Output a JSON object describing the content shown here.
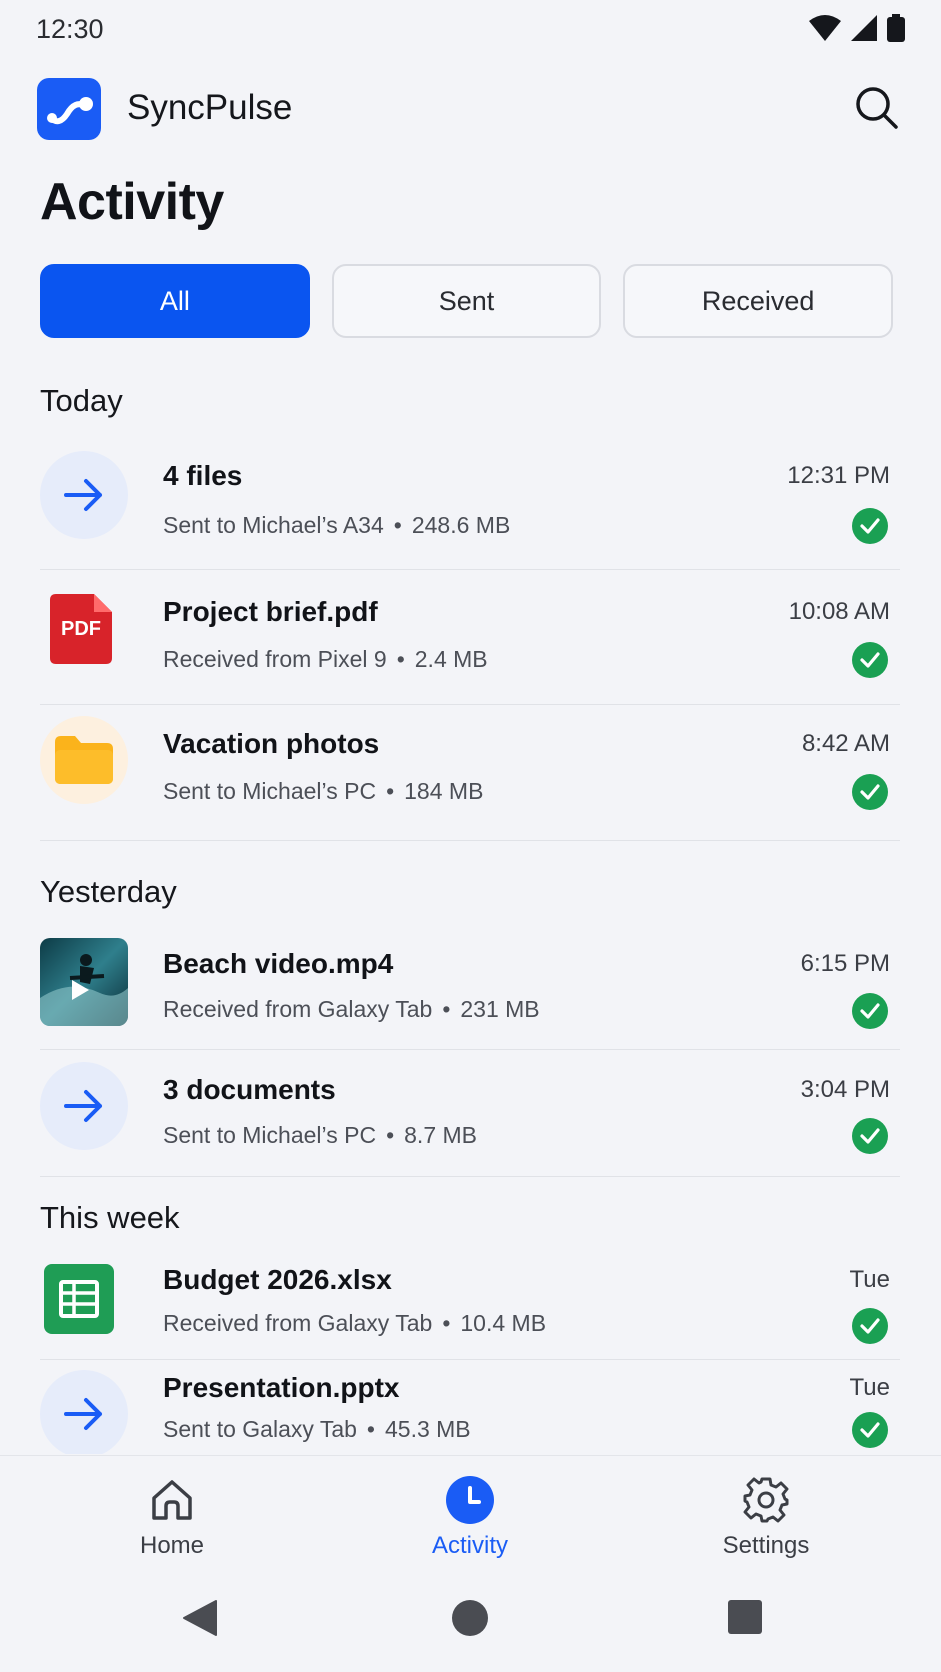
{
  "status_bar": {
    "time": "12:30"
  },
  "header": {
    "app_name": "SyncPulse"
  },
  "page": {
    "title": "Activity"
  },
  "filters": [
    {
      "label": "All",
      "active": true
    },
    {
      "label": "Sent",
      "active": false
    },
    {
      "label": "Received",
      "active": false
    }
  ],
  "sections": {
    "today": "Today",
    "yesterday": "Yesterday",
    "this_week": "This week"
  },
  "items": [
    {
      "title": "4 files",
      "meta_left": "Sent to Michael’s A34",
      "meta_right": "248.6 MB",
      "time": "12:31 PM",
      "icon": "send-arrow-icon"
    },
    {
      "title": "Project brief.pdf",
      "meta_left": "Received from Pixel 9",
      "meta_right": "2.4 MB",
      "time": "10:08 AM",
      "icon": "pdf-icon",
      "icon_text": "PDF"
    },
    {
      "title": "Vacation photos",
      "meta_left": "Sent to Michael’s PC",
      "meta_right": "184 MB",
      "time": "8:42 AM",
      "icon": "folder-icon"
    },
    {
      "title": "Beach video.mp4",
      "meta_left": "Received from Galaxy Tab",
      "meta_right": "231 MB",
      "time": "6:15 PM",
      "icon": "video-thumbnail"
    },
    {
      "title": "3 documents",
      "meta_left": "Sent to Michael’s PC",
      "meta_right": "8.7 MB",
      "time": "3:04 PM",
      "icon": "send-arrow-icon"
    },
    {
      "title": "Budget 2026.xlsx",
      "meta_left": "Received from Galaxy Tab",
      "meta_right": "10.4 MB",
      "time": "Tue",
      "icon": "spreadsheet-icon"
    },
    {
      "title": "Presentation.pptx",
      "meta_left": "Sent to Galaxy Tab",
      "meta_right": "45.3 MB",
      "time": "Tue",
      "icon": "send-arrow-icon"
    }
  ],
  "separator": "•",
  "bottom_nav": [
    {
      "label": "Home",
      "icon": "home-icon",
      "active": false
    },
    {
      "label": "Activity",
      "icon": "clock-icon",
      "active": true
    },
    {
      "label": "Settings",
      "icon": "gear-icon",
      "active": false
    }
  ],
  "colors": {
    "accent": "#1a5cf5",
    "success": "#1aa053",
    "pdf": "#d8232a",
    "folder": "#fbb31b",
    "sheet": "#1f9d55"
  }
}
